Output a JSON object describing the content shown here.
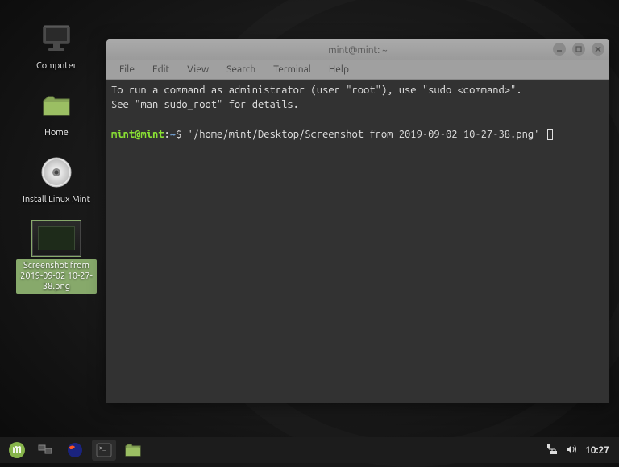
{
  "desktop": {
    "icons": [
      {
        "name": "computer",
        "label": "Computer"
      },
      {
        "name": "home",
        "label": "Home"
      },
      {
        "name": "install",
        "label": "Install Linux Mint"
      },
      {
        "name": "screenshot",
        "label": "Screenshot from 2019-09-02 10-27-38.png",
        "selected": true
      }
    ]
  },
  "terminal": {
    "title": "mint@mint: ~",
    "menu": [
      "File",
      "Edit",
      "View",
      "Search",
      "Terminal",
      "Help"
    ],
    "motd_line1": "To run a command as administrator (user \"root\"), use \"sudo <command>\".",
    "motd_line2": "See \"man sudo_root\" for details.",
    "prompt_user": "mint@mint",
    "prompt_path": "~",
    "prompt_sep1": ":",
    "prompt_sep2": "$",
    "command": "'/home/mint/Desktop/Screenshot from 2019-09-02 10-27-38.png'"
  },
  "panel": {
    "clock": "10:27"
  }
}
